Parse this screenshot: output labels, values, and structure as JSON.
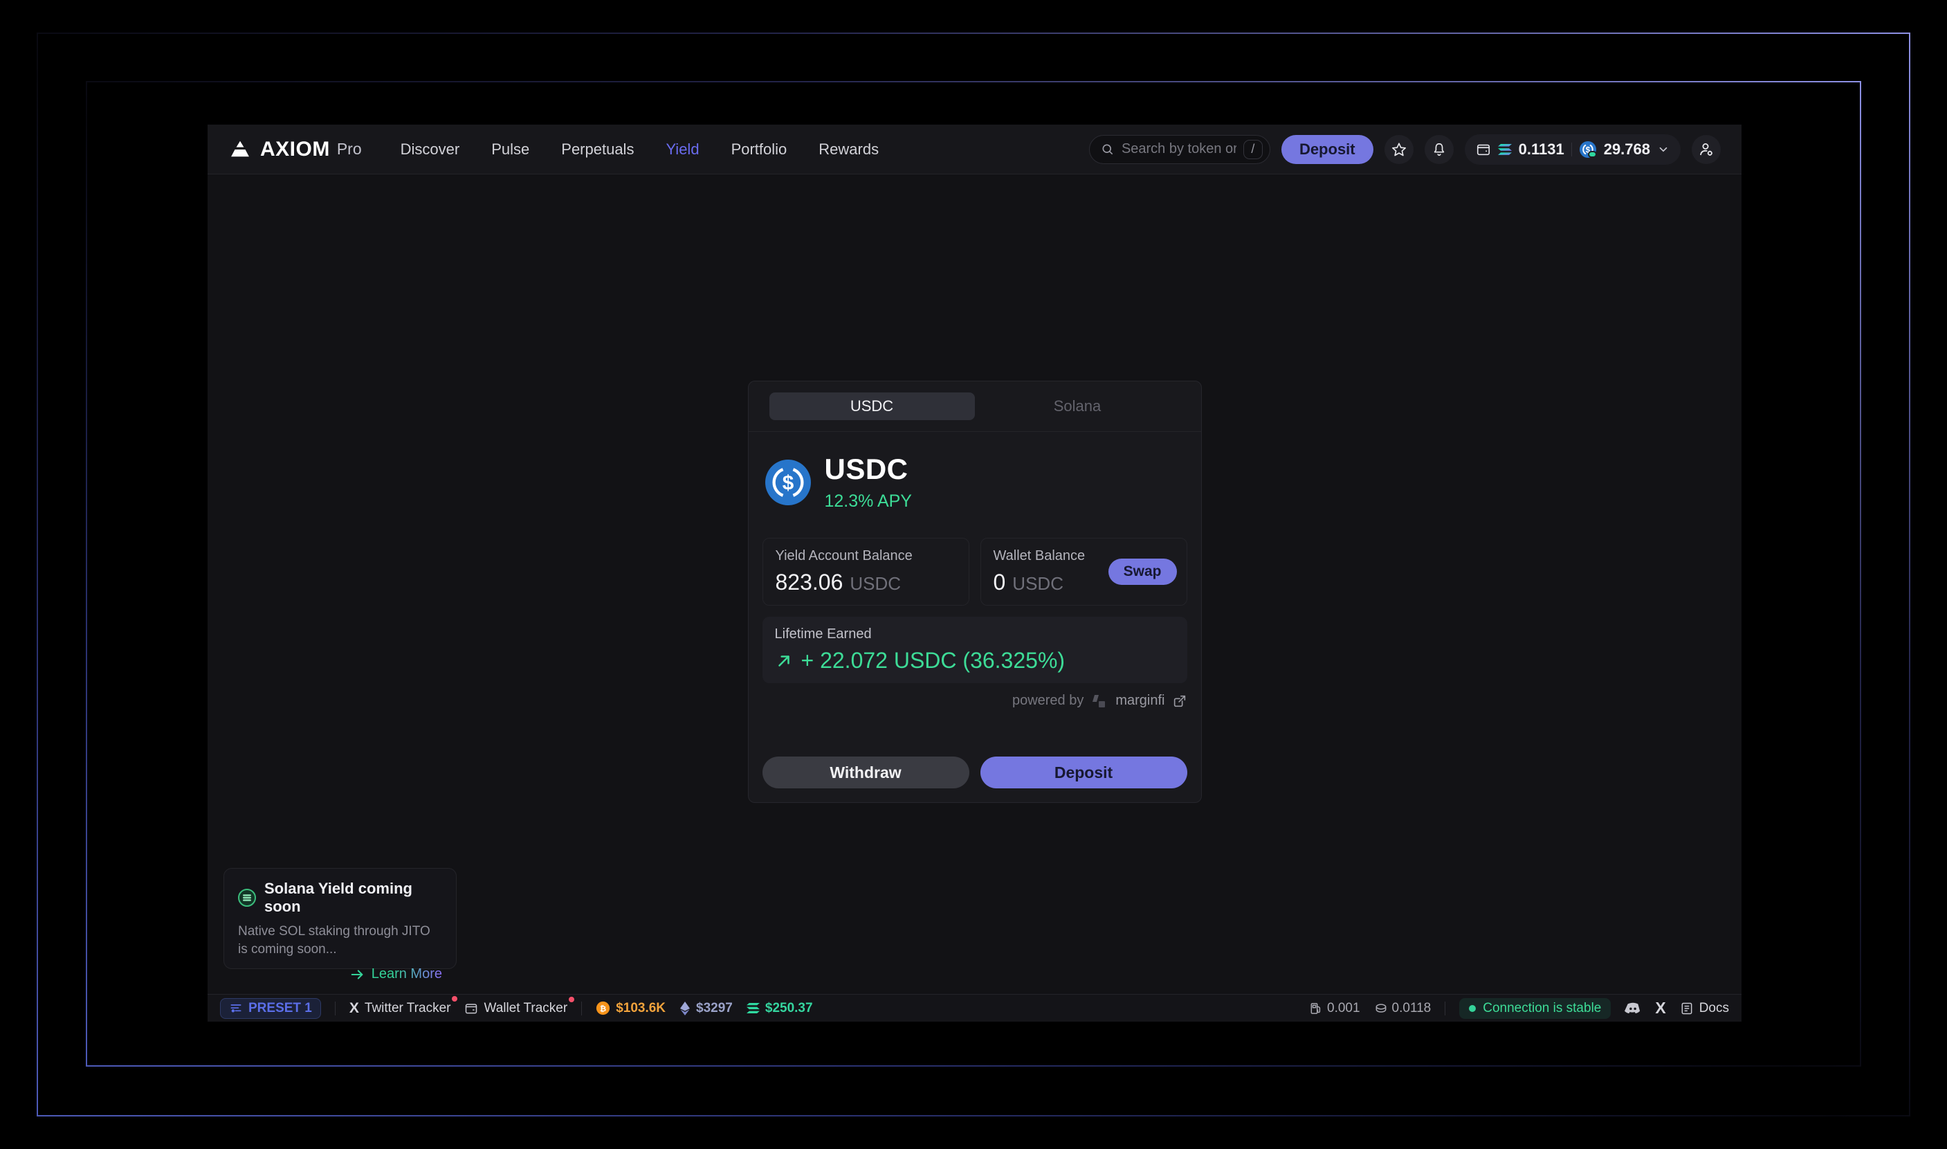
{
  "header": {
    "brand": "AXIOM",
    "brand_suffix": "Pro",
    "nav": [
      "Discover",
      "Pulse",
      "Perpetuals",
      "Yield",
      "Portfolio",
      "Rewards"
    ],
    "search_placeholder": "Search by token or CA...",
    "search_shortcut": "/",
    "deposit_label": "Deposit",
    "wallet": {
      "sol_balance": "0.1131",
      "usdc_balance": "29.768"
    }
  },
  "card": {
    "tabs": [
      "USDC",
      "Solana"
    ],
    "token": {
      "name": "USDC",
      "apy": "12.3% APY"
    },
    "yield_balance": {
      "label": "Yield Account Balance",
      "value": "823.06",
      "unit": "USDC"
    },
    "wallet_balance": {
      "label": "Wallet Balance",
      "value": "0",
      "unit": "USDC",
      "swap_label": "Swap"
    },
    "lifetime": {
      "label": "Lifetime Earned",
      "value": "+ 22.072 USDC (36.325%)"
    },
    "powered_by": {
      "prefix": "powered by",
      "name": "marginfi"
    },
    "actions": {
      "withdraw": "Withdraw",
      "deposit": "Deposit"
    }
  },
  "toast": {
    "title": "Solana Yield coming soon",
    "body": "Native SOL staking through JITO is coming soon...",
    "cta": "Learn More"
  },
  "statusbar": {
    "preset": "PRESET 1",
    "twitter_tracker": "Twitter Tracker",
    "wallet_tracker": "Wallet Tracker",
    "btc_price": "$103.6K",
    "eth_price": "$3297",
    "sol_price": "$250.37",
    "gas": "0.001",
    "priority_fee": "0.0118",
    "connection": "Connection is stable",
    "docs": "Docs"
  },
  "colors": {
    "accent_indigo": "#7577e0",
    "active_nav": "#6a6cf0",
    "positive_green": "#3ddc97",
    "usdc_blue": "#2775CA",
    "btc_orange": "#f2a33c",
    "alert_red": "#f5506a"
  }
}
